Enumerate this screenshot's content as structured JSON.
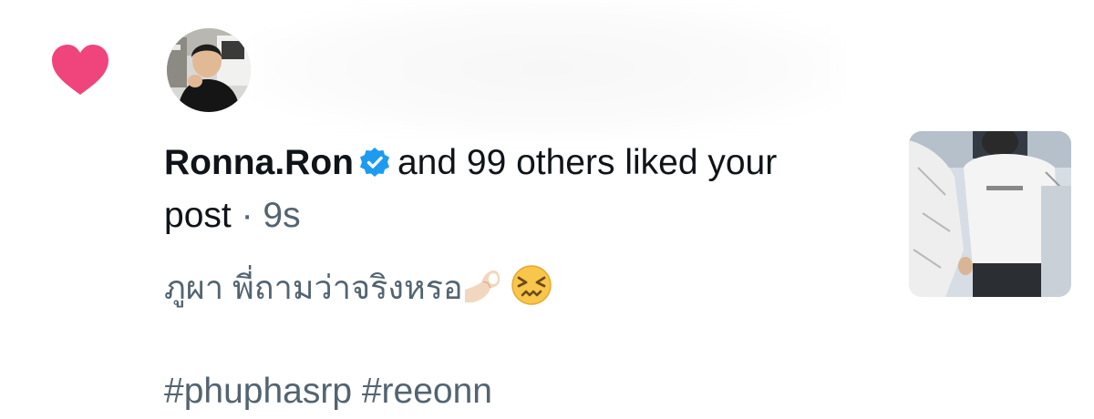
{
  "notification": {
    "type_icon": "heart-icon",
    "type_icon_color": "#f0447d",
    "avatar_icon": "user-avatar",
    "user_name": "Ronna.Ron",
    "verified_icon": "verified-badge-icon",
    "verified_color": "#1d9bf0",
    "action_text": "and 99 others liked your post",
    "separator": "·",
    "time_ago": "9s",
    "post_text": "ภูผา พี่ถามว่าจริงหรอ",
    "post_emojis": [
      "pinching-hand-emoji",
      "confounded-face-emoji"
    ],
    "hashtags": "#phuphasrp #reeonn",
    "thumbnail": "post-image-thumbnail"
  },
  "colors": {
    "primary_text": "#0f1419",
    "secondary_text": "#536471",
    "background": "#ffffff"
  }
}
